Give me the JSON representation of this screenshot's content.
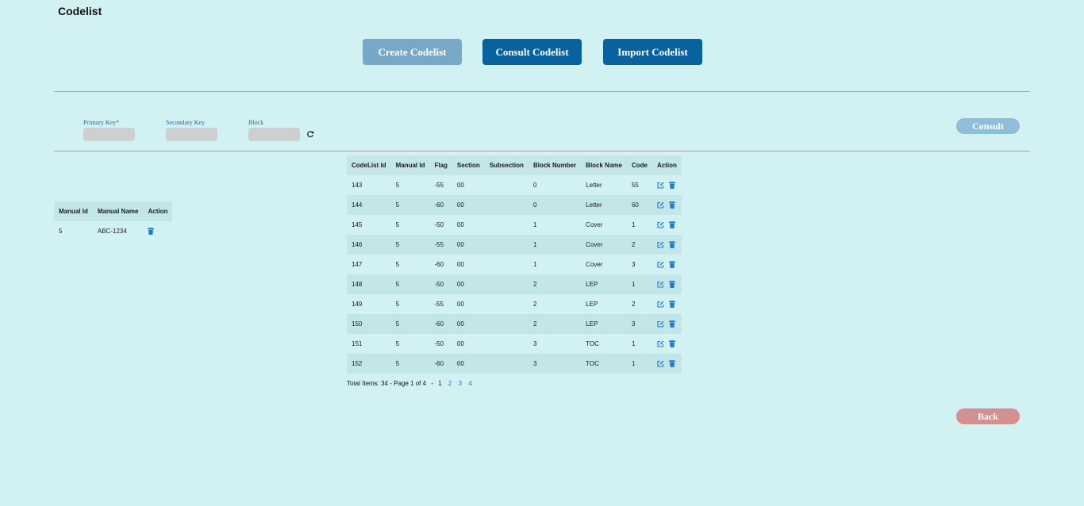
{
  "page": {
    "title": "Codelist"
  },
  "tabs": {
    "create": "Create Codelist",
    "consult": "Consult Codelist",
    "import": "Import Codelist"
  },
  "filters": {
    "primary_key_label": "Primary Key*",
    "secondary_key_label": "Secondary Key",
    "block_label": "Block",
    "consult_label": "Consult"
  },
  "manual_table": {
    "headers": [
      "Manual Id",
      "Manual Name",
      "Action"
    ],
    "rows": [
      {
        "manual_id": "5",
        "manual_name": "ABC-1234"
      }
    ]
  },
  "codelist_table": {
    "headers": [
      "CodeList Id",
      "Manual Id",
      "Flag",
      "Section",
      "Subsection",
      "Block Number",
      "Block Name",
      "Code",
      "Action"
    ],
    "rows": [
      [
        "143",
        "5",
        "-55",
        "00",
        "",
        "0",
        "Letter",
        "55"
      ],
      [
        "144",
        "5",
        "-60",
        "00",
        "",
        "0",
        "Letter",
        "60"
      ],
      [
        "145",
        "5",
        "-50",
        "00",
        "",
        "1",
        "Cover",
        "1"
      ],
      [
        "146",
        "5",
        "-55",
        "00",
        "",
        "1",
        "Cover",
        "2"
      ],
      [
        "147",
        "5",
        "-60",
        "00",
        "",
        "1",
        "Cover",
        "3"
      ],
      [
        "148",
        "5",
        "-50",
        "00",
        "",
        "2",
        "LEP",
        "1"
      ],
      [
        "149",
        "5",
        "-55",
        "00",
        "",
        "2",
        "LEP",
        "2"
      ],
      [
        "150",
        "5",
        "-60",
        "00",
        "",
        "2",
        "LEP",
        "3"
      ],
      [
        "151",
        "5",
        "-50",
        "00",
        "",
        "3",
        "TOC",
        "1"
      ],
      [
        "152",
        "5",
        "-60",
        "00",
        "",
        "3",
        "TOC",
        "1"
      ]
    ]
  },
  "pagination": {
    "summary": "Total Items: 34 - Page 1 of 4",
    "separator": "-",
    "current": "1",
    "pages": [
      "2",
      "3",
      "4"
    ]
  },
  "footer": {
    "back_label": "Back"
  },
  "colors": {
    "background": "#d1f1f2",
    "primary": "#0862a0",
    "icon_blue": "#1f7ad0"
  },
  "icons": {
    "edit": "edit-icon",
    "delete": "trash-icon",
    "refresh": "refresh-icon"
  }
}
